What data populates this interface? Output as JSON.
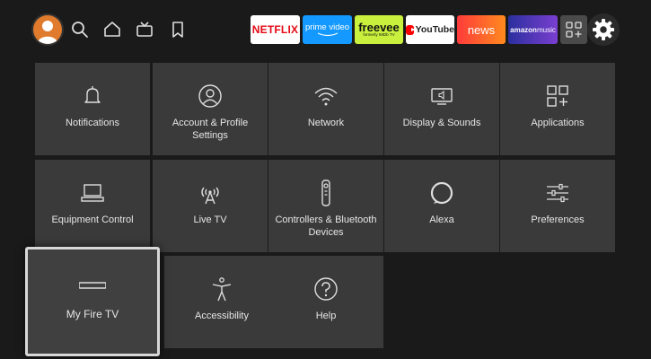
{
  "nav": {
    "apps": {
      "netflix": "NETFLIX",
      "prime_top": "prime video",
      "freevee_main": "freevee",
      "freevee_sub": "formerly IMDb TV",
      "youtube": "YouTube",
      "news": "news",
      "amazon_music_a": "amazon",
      "amazon_music_b": "music"
    }
  },
  "settings": {
    "tiles": [
      {
        "label": "Notifications"
      },
      {
        "label": "Account & Profile Settings"
      },
      {
        "label": "Network"
      },
      {
        "label": "Display & Sounds"
      },
      {
        "label": "Applications"
      },
      {
        "label": "Equipment Control"
      },
      {
        "label": "Live TV"
      },
      {
        "label": "Controllers & Bluetooth Devices"
      },
      {
        "label": "Alexa"
      },
      {
        "label": "Preferences"
      },
      {
        "label": "My Fire TV"
      },
      {
        "label": "Accessibility"
      },
      {
        "label": "Help"
      }
    ]
  },
  "colors": {
    "background": "#1a1a1a",
    "tile": "#3a3a3a",
    "netflix_red": "#e50914",
    "prime_blue": "#1399ff",
    "freevee_green": "#c8f03c"
  }
}
